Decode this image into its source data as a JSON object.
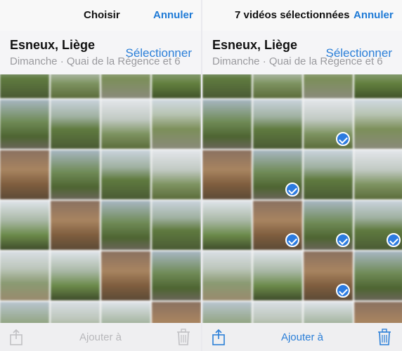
{
  "left": {
    "nav": {
      "title": "Choisir",
      "cancel": "Annuler"
    },
    "header": {
      "place": "Esneux, Liège",
      "subtitle": "Dimanche  ·  Quai de la Régence et 6",
      "select": "Sélectionner"
    },
    "toolbar": {
      "add": "Ajouter à",
      "share_icon": "share-icon",
      "trash_icon": "trash-icon"
    }
  },
  "right": {
    "nav": {
      "title": "7 vidéos sélectionnées",
      "cancel": "Annuler"
    },
    "header": {
      "place": "Esneux, Liège",
      "subtitle": "Dimanche  ·  Quai de la Régence et 6",
      "select": "Sélectionner"
    },
    "toolbar": {
      "add": "Ajouter à",
      "share_icon": "share-icon",
      "trash_icon": "trash-icon"
    }
  },
  "colors": {
    "accent": "#2b7fd8",
    "check": "#2c7be0"
  }
}
